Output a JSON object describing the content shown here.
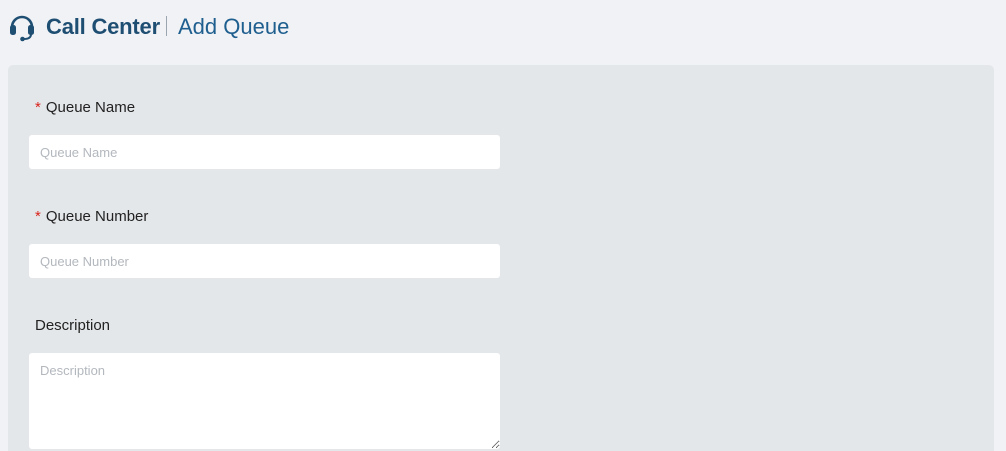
{
  "header": {
    "icon": "headset-icon",
    "title": "Call Center",
    "subtitle": "Add Queue"
  },
  "form": {
    "required_marker": "*",
    "queue_name": {
      "label": "Queue Name",
      "placeholder": "Queue Name",
      "value": ""
    },
    "queue_number": {
      "label": "Queue Number",
      "placeholder": "Queue Number",
      "value": ""
    },
    "description": {
      "label": "Description",
      "placeholder": "Description",
      "value": ""
    }
  },
  "colors": {
    "title": "#1f4e73",
    "required": "#d9241c",
    "card_bg": "#e4e7ea",
    "page_bg": "#f0f2f5"
  }
}
